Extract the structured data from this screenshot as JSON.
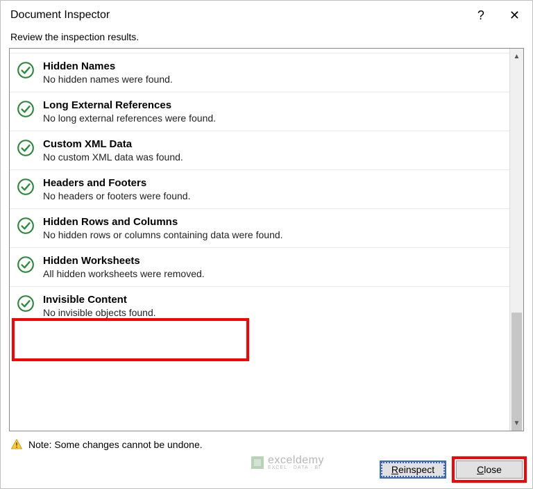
{
  "titlebar": {
    "title": "Document Inspector",
    "help_label": "?",
    "close_label": "✕"
  },
  "subtitle": "Review the inspection results.",
  "items": [
    {
      "title": "Hidden Names",
      "desc": "No hidden names were found."
    },
    {
      "title": "Long External References",
      "desc": "No long external references were found."
    },
    {
      "title": "Custom XML Data",
      "desc": "No custom XML data was found."
    },
    {
      "title": "Headers and Footers",
      "desc": "No headers or footers were found."
    },
    {
      "title": "Hidden Rows and Columns",
      "desc": "No hidden rows or columns containing data were found."
    },
    {
      "title": "Hidden Worksheets",
      "desc": "All hidden worksheets were removed."
    },
    {
      "title": "Invisible Content",
      "desc": "No invisible objects found."
    }
  ],
  "footer": {
    "note": "Note: Some changes cannot be undone.",
    "reinspect_label": "Reinspect",
    "close_label": "Close"
  },
  "watermark": {
    "main": "exceldemy",
    "sub": "EXCEL · DATA · BI"
  }
}
